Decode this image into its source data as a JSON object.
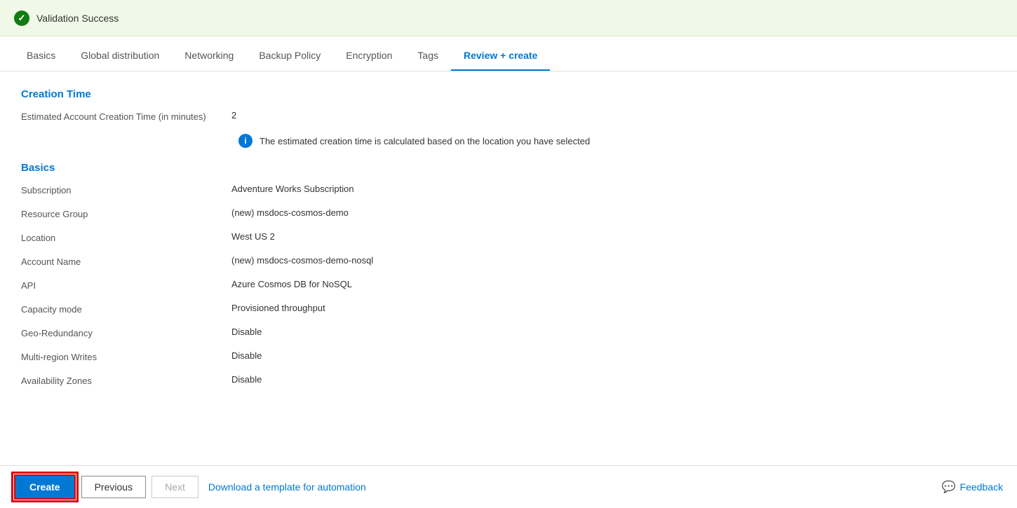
{
  "validation": {
    "text": "Validation Success"
  },
  "tabs": [
    {
      "label": "Basics",
      "active": false
    },
    {
      "label": "Global distribution",
      "active": false
    },
    {
      "label": "Networking",
      "active": false
    },
    {
      "label": "Backup Policy",
      "active": false
    },
    {
      "label": "Encryption",
      "active": false
    },
    {
      "label": "Tags",
      "active": false
    },
    {
      "label": "Review + create",
      "active": true
    }
  ],
  "sections": {
    "creation_time": {
      "title": "Creation Time",
      "estimated_label": "Estimated Account Creation Time (in minutes)",
      "estimated_value": "2",
      "note": "The estimated creation time is calculated based on the location you have selected"
    },
    "basics": {
      "title": "Basics",
      "rows": [
        {
          "label": "Subscription",
          "value": "Adventure Works Subscription"
        },
        {
          "label": "Resource Group",
          "value": "(new) msdocs-cosmos-demo"
        },
        {
          "label": "Location",
          "value": "West US 2"
        },
        {
          "label": "Account Name",
          "value": "(new) msdocs-cosmos-demo-nosql"
        },
        {
          "label": "API",
          "value": "Azure Cosmos DB for NoSQL"
        },
        {
          "label": "Capacity mode",
          "value": "Provisioned throughput"
        },
        {
          "label": "Geo-Redundancy",
          "value": "Disable"
        },
        {
          "label": "Multi-region Writes",
          "value": "Disable"
        },
        {
          "label": "Availability Zones",
          "value": "Disable"
        }
      ]
    }
  },
  "footer": {
    "create_label": "Create",
    "previous_label": "Previous",
    "next_label": "Next",
    "automation_link": "Download a template for automation",
    "feedback_label": "Feedback"
  }
}
